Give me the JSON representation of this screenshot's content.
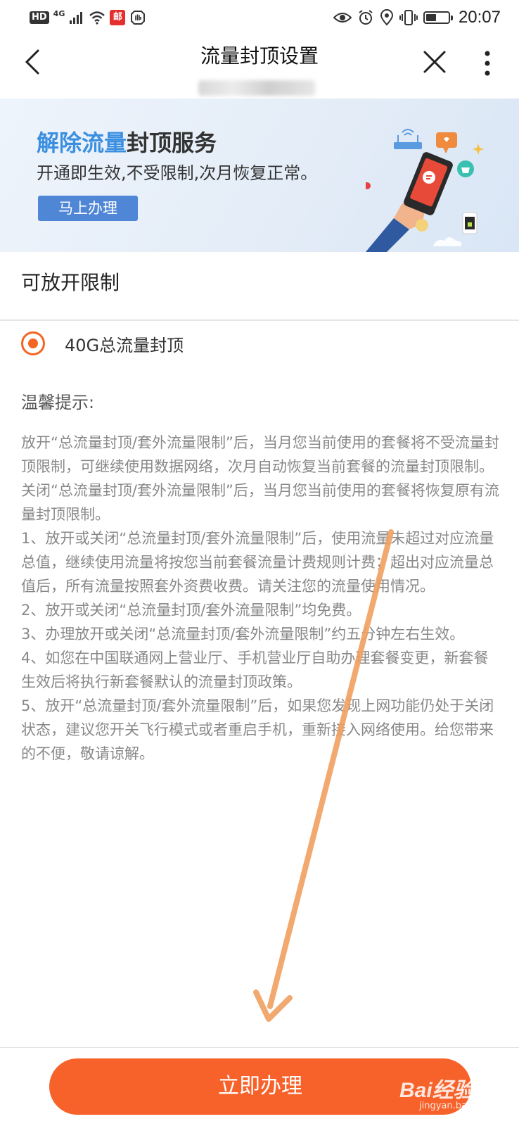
{
  "status_bar": {
    "hd": "HD",
    "network": "4G",
    "badge": "邮",
    "time": "20:07",
    "icons": [
      "signal-icon",
      "wifi-icon",
      "hand-icon",
      "eye-icon",
      "alarm-icon",
      "location-icon",
      "vibrate-icon",
      "battery-icon"
    ]
  },
  "nav": {
    "title": "流量封顶设置",
    "icons": [
      "back-icon",
      "close-icon",
      "more-icon"
    ]
  },
  "banner": {
    "title_highlight": "解除流量",
    "title_rest": "封顶服务",
    "description": "开通即生效,不受限制,次月恢复正常。",
    "button_label": "马上办理"
  },
  "section": {
    "title": "可放开限制"
  },
  "option": {
    "label": "40G总流量封顶",
    "selected": true
  },
  "tips": {
    "title": "温馨提示:",
    "paragraphs": [
      "放开“总流量封顶/套外流量限制”后，当月您当前使用的套餐将不受流量封顶限制，可继续使用数据网络，次月自动恢复当前套餐的流量封顶限制。关闭“总流量封顶/套外流量限制”后，当月您当前使用的套餐将恢复原有流量封顶限制。",
      "1、放开或关闭“总流量封顶/套外流量限制”后，使用流量未超过对应流量总值，继续使用流量将按您当前套餐流量计费规则计费；超出对应流量总值后，所有流量按照套外资费收费。请关注您的流量使用情况。",
      "2、放开或关闭“总流量封顶/套外流量限制”均免费。",
      "3、办理放开或关闭“总流量封顶/套外流量限制”约五分钟左右生效。",
      "4、如您在中国联通网上营业厅、手机营业厅自助办理套餐变更，新套餐生效后将执行新套餐默认的流量封顶政策。",
      "5、放开“总流量封顶/套外流量限制”后，如果您发现上网功能仍处于关闭状态，建议您开关飞行模式或者重启手机，重新接入网络使用。给您带来的不便，敬请谅解。"
    ]
  },
  "footer": {
    "submit_label": "立即办理",
    "watermark_main": "Bai经验",
    "watermark_sub": "jingyan.baidu.com"
  },
  "colors": {
    "accent": "#f7622a",
    "radio": "#f26522",
    "banner_blue": "#3b8fe0",
    "arrow": "#f0a060"
  }
}
